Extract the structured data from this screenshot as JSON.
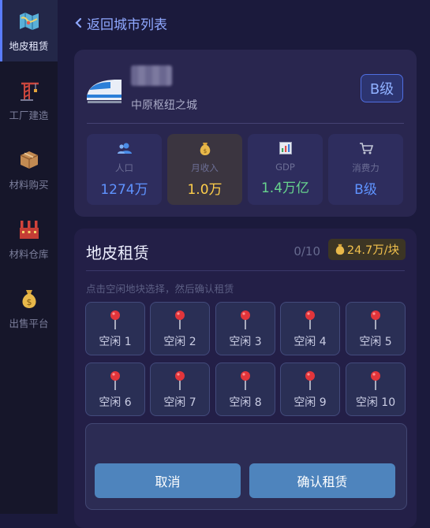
{
  "sidebar": {
    "items": [
      {
        "label": "地皮租赁",
        "icon": "map-icon",
        "active": true
      },
      {
        "label": "工厂建造",
        "icon": "crane-icon",
        "active": false
      },
      {
        "label": "材料购买",
        "icon": "box-icon",
        "active": false
      },
      {
        "label": "材料仓库",
        "icon": "factory-icon",
        "active": false
      },
      {
        "label": "出售平台",
        "icon": "money-bag-icon",
        "active": false
      }
    ]
  },
  "back": {
    "label": "返回城市列表"
  },
  "city": {
    "subtitle": "中原枢纽之城",
    "grade": "B级",
    "stats": [
      {
        "label": "人口",
        "value": "1274万",
        "color": "#5f93ff",
        "icon": "people-icon"
      },
      {
        "label": "月收入",
        "value": "1.0万",
        "color": "#ffcf4a",
        "icon": "money-bag-icon"
      },
      {
        "label": "GDP",
        "value": "1.4万亿",
        "color": "#67d48e",
        "icon": "bar-chart-icon"
      },
      {
        "label": "消费力",
        "value": "B级",
        "color": "#5f93ff",
        "icon": "cart-icon"
      }
    ]
  },
  "lease": {
    "title": "地皮租赁",
    "count": "0/10",
    "price": "24.7万/块",
    "hint": "点击空闲地块选择，然后确认租赁",
    "plots": [
      "空闲 1",
      "空闲 2",
      "空闲 3",
      "空闲 4",
      "空闲 5",
      "空闲 6",
      "空闲 7",
      "空闲 8",
      "空闲 9",
      "空闲 10"
    ],
    "cancel_label": "取消",
    "confirm_label": "确认租赁"
  },
  "colors": {
    "accent": "#5a7cff",
    "button": "#4e84bd",
    "gold": "#f2c14d"
  }
}
